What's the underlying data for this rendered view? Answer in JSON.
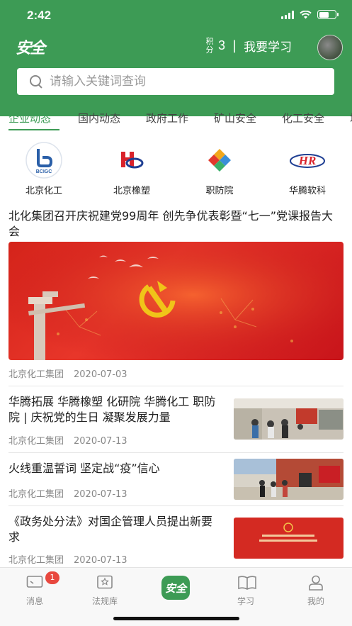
{
  "status": {
    "time": "2:42"
  },
  "header": {
    "logo_text": "安全",
    "points_label": "积分",
    "points_value": "3",
    "separator": "|",
    "learn_link": "我要学习"
  },
  "search": {
    "placeholder": "请输入关键词查询"
  },
  "tabs": [
    {
      "label": "企业动态",
      "active": true
    },
    {
      "label": "国内动态",
      "active": false
    },
    {
      "label": "政府工作",
      "active": false
    },
    {
      "label": "矿山安全",
      "active": false
    },
    {
      "label": "化工安全",
      "active": false
    },
    {
      "label": "培",
      "active": false
    }
  ],
  "orgs": [
    {
      "name": "北京化工",
      "logo_text": "BCIGC"
    },
    {
      "name": "北京橡塑",
      "logo_text": ""
    },
    {
      "name": "职防院",
      "logo_text": ""
    },
    {
      "name": "华腾软科",
      "logo_text": "HR"
    }
  ],
  "news": [
    {
      "title": "北化集团召开庆祝建党99周年 创先争优表彰暨“七一”党课报告大会",
      "source": "北京化工集团",
      "date": "2020-07-03"
    },
    {
      "title": "华腾拓展 华腾橡塑 化研院 华腾化工 职防院 | 庆祝党的生日 凝聚发展力量",
      "source": "北京化工集团",
      "date": "2020-07-13"
    },
    {
      "title": "火线重温誓词 坚定战“疫”信心",
      "source": "北京化工集团",
      "date": "2020-07-13"
    },
    {
      "title": "《政务处分法》对国企管理人员提出新要求",
      "source": "北京化工集团",
      "date": "2020-07-13"
    }
  ],
  "tabbar": {
    "messages": "消息",
    "messages_badge": "1",
    "regulations": "法规库",
    "center_logo": "安全",
    "study": "学习",
    "mine": "我的"
  },
  "colors": {
    "brand_green": "#3d9b55",
    "badge_red": "#e8483f"
  }
}
